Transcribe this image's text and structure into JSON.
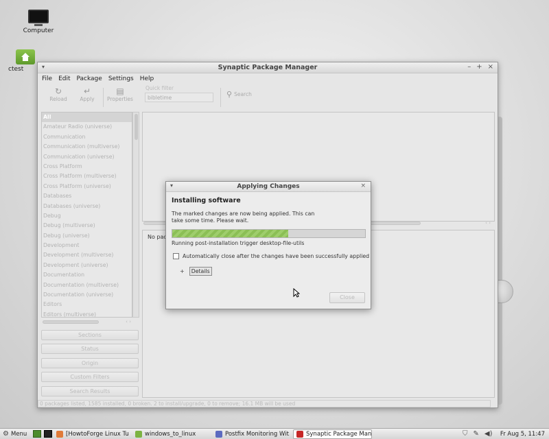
{
  "desktop": {
    "icons": [
      {
        "label": "Computer"
      },
      {
        "label": "ctest"
      }
    ]
  },
  "window": {
    "title": "Synaptic Package Manager",
    "controls": [
      "–",
      "+",
      "×"
    ],
    "menu": [
      "File",
      "Edit",
      "Package",
      "Settings",
      "Help"
    ],
    "toolbar": {
      "reload": "Reload",
      "apply": "Apply",
      "properties": "Properties",
      "quick_filter_label": "Quick filter",
      "quick_filter_value": "bibletime",
      "search": "Search"
    },
    "categories": [
      "All",
      "Amateur Radio (universe)",
      "Communication",
      "Communication (multiverse)",
      "Communication (universe)",
      "Cross Platform",
      "Cross Platform (multiverse)",
      "Cross Platform (universe)",
      "Databases",
      "Databases (universe)",
      "Debug",
      "Debug (multiverse)",
      "Debug (universe)",
      "Development",
      "Development (multiverse)",
      "Development (universe)",
      "Documentation",
      "Documentation (multiverse)",
      "Documentation (universe)",
      "Editors",
      "Editors (multiverse)"
    ],
    "side_buttons": [
      "Sections",
      "Status",
      "Origin",
      "Custom Filters",
      "Search Results"
    ],
    "description_text": "No pac",
    "status_bar": "0 packages listed, 1585 installed, 0 broken. 2 to install/upgrade, 0 to remove; 16.1 MB will be used"
  },
  "dialog": {
    "title": "Applying Changes",
    "heading": "Installing software",
    "message": "The marked changes are now being applied. This can take some time. Please wait.",
    "progress": 0.6,
    "progress_text": "Running post-installation trigger desktop-file-utils",
    "auto_close_label": "Automatically close after the changes have been successfully applied",
    "auto_close_checked": false,
    "expander": "+",
    "details_label": "Details",
    "close_label": "Close"
  },
  "taskbar": {
    "menu_label": "Menu",
    "tasks": [
      {
        "label": "[HowtoForge Linux Tu...",
        "color": "#e07b39"
      },
      {
        "label": "windows_to_linux",
        "color": "#7cb342"
      },
      {
        "label": "Postfix Monitoring Wit...",
        "color": "#5c6bc0"
      },
      {
        "label": "Synaptic Package Man...",
        "color": "#c62828"
      }
    ],
    "clock": "Fr Aug  5, 11:47"
  }
}
